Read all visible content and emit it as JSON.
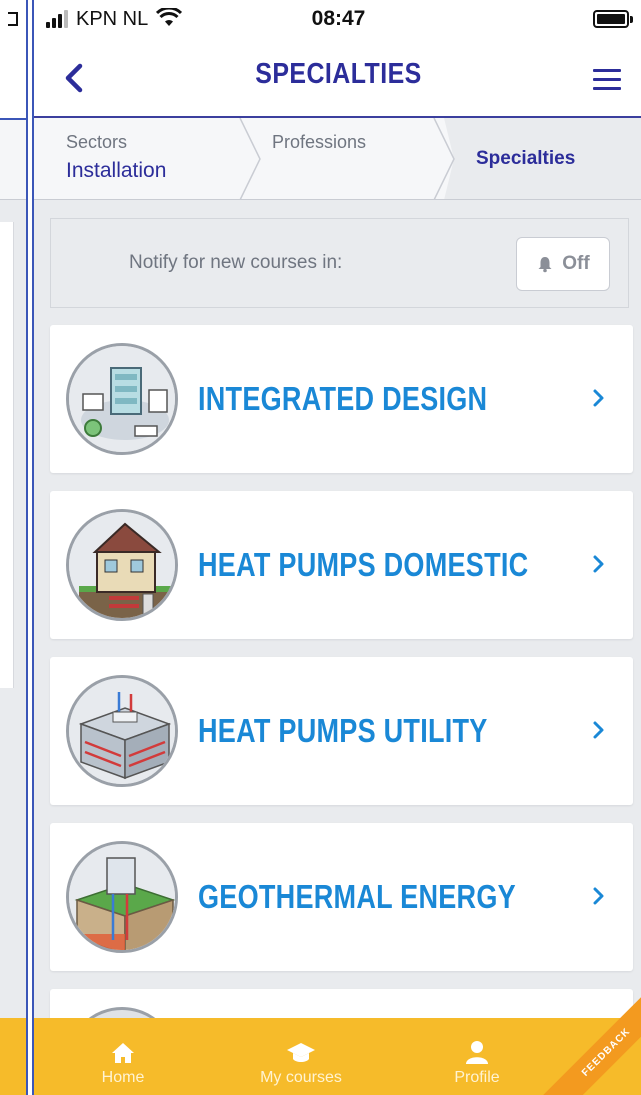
{
  "status_bar": {
    "carrier": "KPN NL",
    "time": "08:47"
  },
  "header": {
    "title": "SPECIALTIES"
  },
  "breadcrumb": {
    "sectors_label": "Sectors",
    "sectors_value": "Installation",
    "professions_label": "Professions",
    "specialties_label": "Specialties"
  },
  "notify": {
    "text": "Notify for new courses in:",
    "toggle_label": "Off"
  },
  "specialties": [
    {
      "label": "INTEGRATED DESIGN",
      "icon": "integrated-design-illustration"
    },
    {
      "label": "HEAT PUMPS DOMESTIC",
      "icon": "house-heat-pump-illustration"
    },
    {
      "label": "HEAT PUMPS UTILITY",
      "icon": "building-heat-pump-illustration"
    },
    {
      "label": "GEOTHERMAL ENERGY",
      "icon": "geothermal-illustration"
    }
  ],
  "tabbar": {
    "home": "Home",
    "my_courses": "My courses",
    "profile": "Profile"
  },
  "feedback_label": "FEEDBACK",
  "colors": {
    "brand": "#2c2d9a",
    "link": "#1a88d6",
    "tabbar": "#f6bb2a"
  }
}
